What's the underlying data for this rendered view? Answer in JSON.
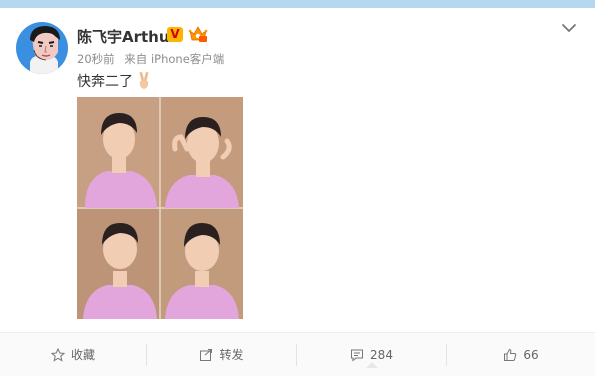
{
  "post": {
    "author": "陈飞宇Arthur",
    "verified_badge": "V",
    "time": "20秒前",
    "source": "来自 iPhone客户端",
    "text": "快奔二了",
    "emoji": "victory-hand"
  },
  "actions": {
    "favorite": "收藏",
    "repost": "转发",
    "comment": "284",
    "like": "66"
  },
  "colors": {
    "topbar": "#b6d8ee",
    "badge_bg": "#ffb400",
    "badge_text": "#d40000",
    "photo_bg": "#c8a083",
    "shirt": "#e3a6dc"
  }
}
